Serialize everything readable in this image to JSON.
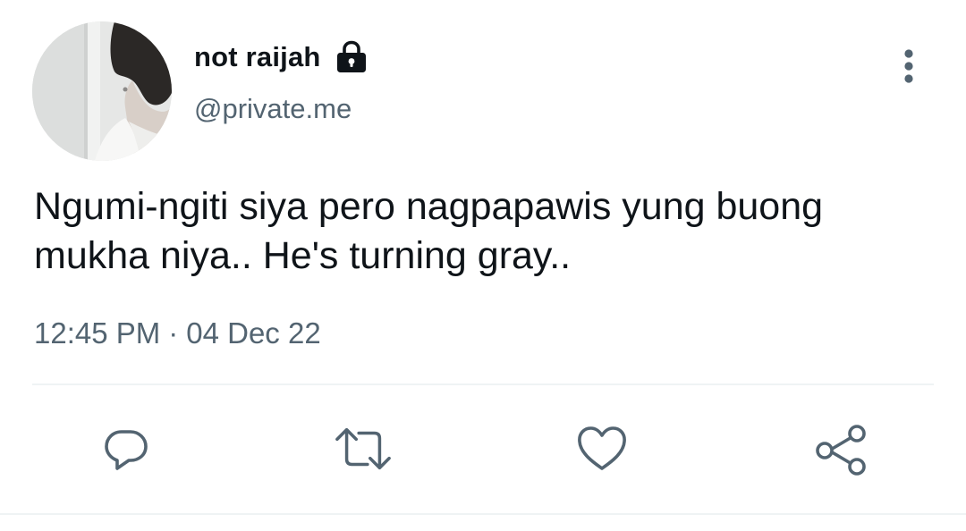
{
  "author": {
    "display_name": "not raijah",
    "handle": "@private.me",
    "avatar_icon": "profile-photo",
    "protected_icon": "lock-icon"
  },
  "tweet": {
    "text": "Ngumi-ngiti siya pero nagpapawis yung buong mukha niya.. He's turning gray..",
    "time": "12:45 PM",
    "separator": "·",
    "date": "04 Dec 22"
  },
  "icons": {
    "more": "more-vertical-icon",
    "reply": "reply-icon",
    "retweet": "retweet-icon",
    "like": "heart-icon",
    "share": "share-icon"
  },
  "colors": {
    "text_primary": "#0f1419",
    "text_secondary": "#536471",
    "icon": "#536471",
    "divider": "#eff3f4"
  }
}
